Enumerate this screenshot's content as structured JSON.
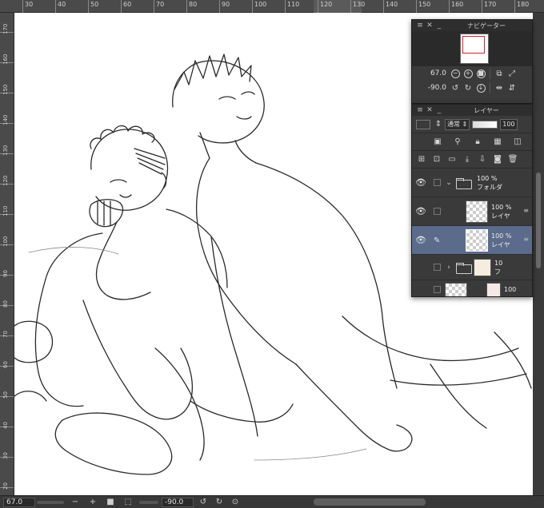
{
  "ruler": {
    "top_labels": [
      "30",
      "40",
      "50",
      "60",
      "70",
      "80",
      "90",
      "100",
      "110",
      "120",
      "130",
      "140",
      "150",
      "160",
      "170",
      "180"
    ],
    "left_labels": [
      "170",
      "160",
      "150",
      "140",
      "130",
      "120",
      "110",
      "100",
      "90",
      "80",
      "70",
      "60",
      "50",
      "40",
      "30",
      "20"
    ]
  },
  "navigator": {
    "title": "ナビゲーター",
    "zoom_value": "67.0",
    "rotation_value": "-90.0"
  },
  "layers": {
    "title": "レイヤー",
    "blend_mode": "通常",
    "opacity": "100",
    "rows": [
      {
        "opacity": "100 %",
        "name": "フォルダ",
        "type": "folder",
        "visible": true,
        "selected": false
      },
      {
        "opacity": "100 %",
        "name": "レイヤ",
        "type": "layer",
        "visible": true,
        "selected": false
      },
      {
        "opacity": "100 %",
        "name": "レイヤ",
        "type": "layer",
        "visible": true,
        "selected": true
      },
      {
        "opacity": "10",
        "name": "フ",
        "type": "folder",
        "visible": false,
        "selected": false
      },
      {
        "opacity": "100",
        "name": "",
        "type": "layer",
        "visible": false,
        "selected": false
      }
    ]
  },
  "statusbar": {
    "zoom": "67.0",
    "rotation": "-90.0"
  },
  "colors": {
    "panel_bg": "#3a3a3a",
    "selected_layer": "#5b6b8c",
    "nav_frame": "#e0202a"
  }
}
